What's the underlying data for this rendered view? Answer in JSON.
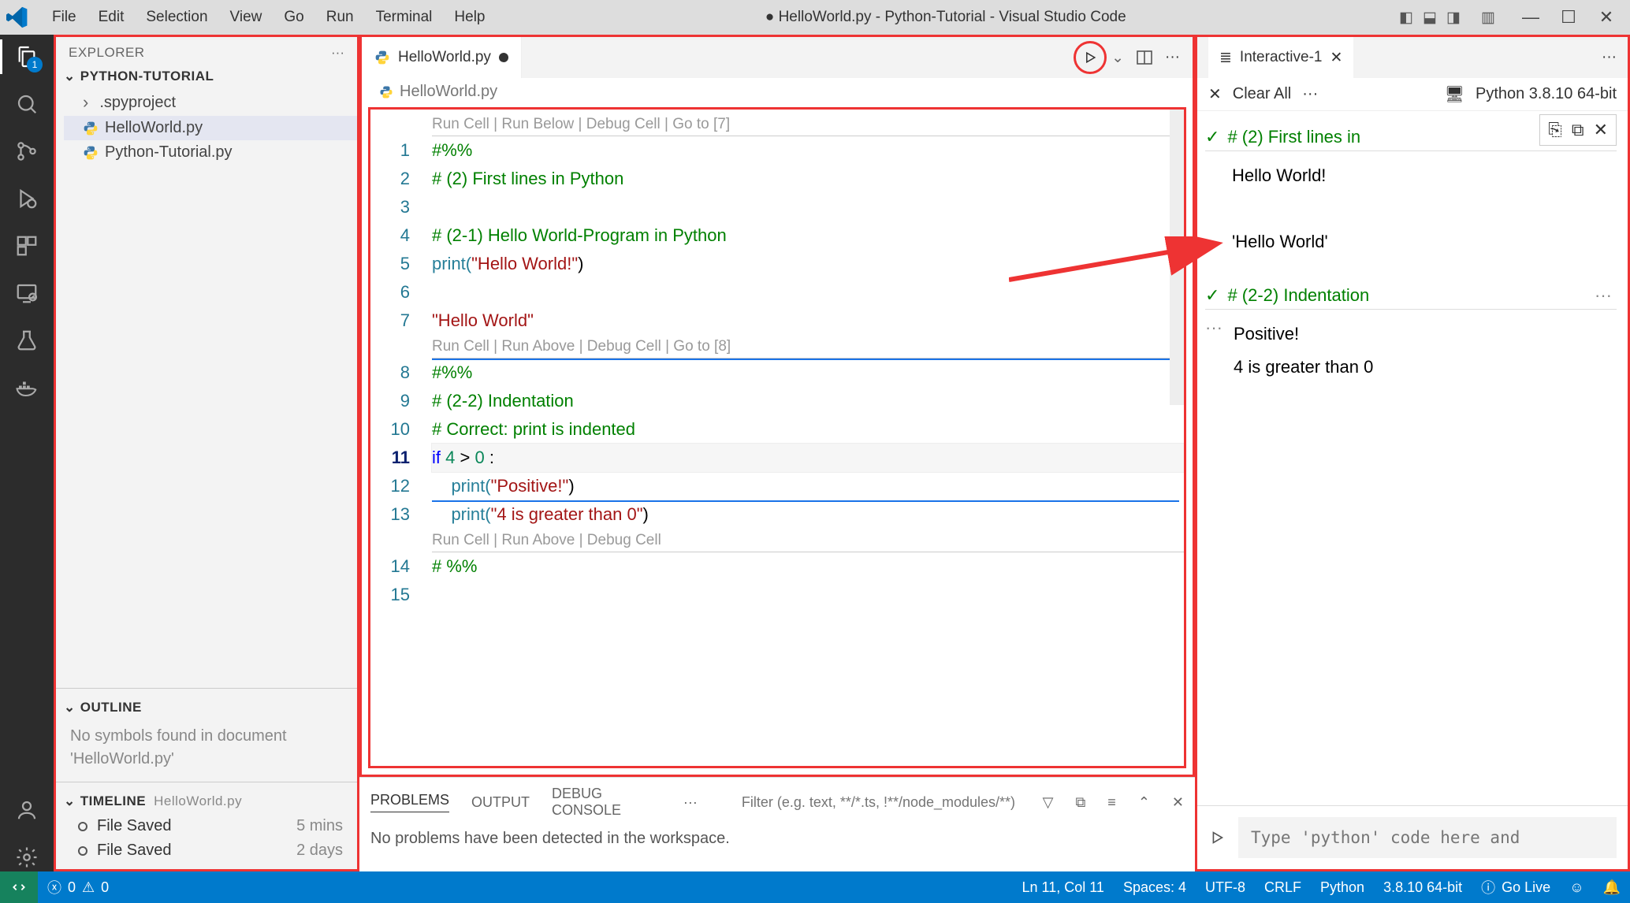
{
  "menubar": [
    "File",
    "Edit",
    "Selection",
    "View",
    "Go",
    "Run",
    "Terminal",
    "Help"
  ],
  "window_title": "● HelloWorld.py - Python-Tutorial - Visual Studio Code",
  "activity_badge": "1",
  "explorer": {
    "title": "EXPLORER",
    "project": "PYTHON-TUTORIAL",
    "items": [
      {
        "kind": "folder",
        "label": ".spyproject"
      },
      {
        "kind": "py",
        "label": "HelloWorld.py",
        "selected": true
      },
      {
        "kind": "py",
        "label": "Python-Tutorial.py"
      }
    ],
    "outline_title": "OUTLINE",
    "outline_body": "No symbols found in document 'HelloWorld.py'",
    "timeline_title": "TIMELINE",
    "timeline_file": "HelloWorld.py",
    "timeline": [
      {
        "label": "File Saved",
        "time": "5 mins"
      },
      {
        "label": "File Saved",
        "time": "2 days"
      }
    ]
  },
  "editor": {
    "tab_label": "HelloWorld.py",
    "breadcrumb": "HelloWorld.py",
    "codelens1": "Run Cell | Run Below | Debug Cell | Go to [7]",
    "codelens2": "Run Cell | Run Above | Debug Cell | Go to [8]",
    "codelens3": "Run Cell | Run Above | Debug Cell",
    "lines": {
      "l1": "#%%",
      "l2": "# (2) First lines in Python",
      "l4": "# (2-1) Hello World-Program in Python",
      "l5a": "print(",
      "l5b": "\"Hello World!\"",
      "l5c": ")",
      "l7": "\"Hello World\"",
      "l8": "#%%",
      "l9": "# (2-2) Indentation",
      "l10": "# Correct: print is indented",
      "l11a": "if ",
      "l11b": "4",
      "l11c": " > ",
      "l11d": "0",
      "l11e": " :",
      "l12a": "    print(",
      "l12b": "\"Positive!\"",
      "l12c": ")",
      "l13a": "    print(",
      "l13b": "\"4 is greater than 0\"",
      "l13c": ")",
      "l14": "# %%"
    }
  },
  "panel": {
    "tabs": [
      "PROBLEMS",
      "OUTPUT",
      "DEBUG CONSOLE"
    ],
    "filter_placeholder": "Filter (e.g. text, **/*.ts, !**/node_modules/**)",
    "body": "No problems have been detected in the workspace."
  },
  "interactive": {
    "tab": "Interactive-1",
    "clear": "Clear All",
    "kernel": "Python 3.8.10 64-bit",
    "cell1_hdr": "# (2) First lines in",
    "cell1_out": [
      "Hello World!",
      "'Hello World'"
    ],
    "cell2_hdr": "# (2-2) Indentation",
    "cell2_out": [
      "Positive!",
      "4 is greater than 0"
    ],
    "input_placeholder": "Type 'python' code here and"
  },
  "status": {
    "errors": "0",
    "warnings": "0",
    "pos": "Ln 11, Col 11",
    "spaces": "Spaces: 4",
    "enc": "UTF-8",
    "eol": "CRLF",
    "lang": "Python",
    "interp": "3.8.10 64-bit",
    "golive": "Go Live"
  }
}
